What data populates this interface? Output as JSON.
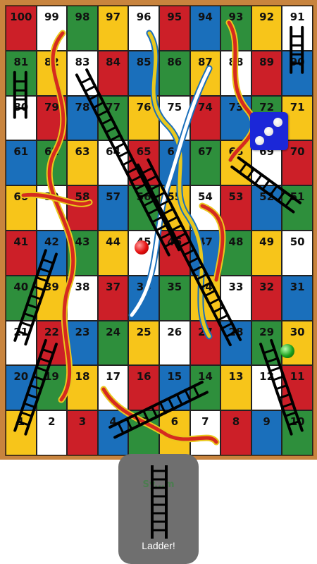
{
  "board": {
    "rows": [
      [
        100,
        99,
        98,
        97,
        96,
        95,
        94,
        93,
        92,
        91
      ],
      [
        81,
        82,
        83,
        84,
        85,
        86,
        87,
        88,
        89,
        90
      ],
      [
        80,
        79,
        78,
        77,
        76,
        75,
        74,
        73,
        72,
        71
      ],
      [
        61,
        62,
        63,
        64,
        65,
        66,
        67,
        68,
        69,
        70
      ],
      [
        60,
        59,
        58,
        57,
        56,
        55,
        54,
        53,
        52,
        51
      ],
      [
        41,
        42,
        43,
        44,
        45,
        46,
        47,
        48,
        49,
        50
      ],
      [
        40,
        39,
        38,
        37,
        36,
        35,
        34,
        33,
        32,
        31
      ],
      [
        21,
        22,
        23,
        24,
        25,
        26,
        27,
        28,
        29,
        30
      ],
      [
        20,
        19,
        18,
        17,
        16,
        15,
        14,
        13,
        12,
        11
      ],
      [
        1,
        2,
        3,
        4,
        5,
        6,
        7,
        8,
        9,
        10
      ]
    ],
    "colors": [
      [
        "red",
        "white",
        "green",
        "yellow",
        "white",
        "red",
        "blue",
        "green",
        "yellow",
        "white"
      ],
      [
        "green",
        "yellow",
        "white",
        "red",
        "blue",
        "green",
        "yellow",
        "white",
        "red",
        "blue"
      ],
      [
        "white",
        "red",
        "blue",
        "green",
        "yellow",
        "white",
        "red",
        "blue",
        "green",
        "yellow"
      ],
      [
        "blue",
        "green",
        "yellow",
        "white",
        "red",
        "blue",
        "green",
        "yellow",
        "white",
        "red"
      ],
      [
        "yellow",
        "white",
        "red",
        "blue",
        "green",
        "yellow",
        "white",
        "red",
        "blue",
        "green"
      ],
      [
        "red",
        "blue",
        "green",
        "yellow",
        "white",
        "red",
        "blue",
        "green",
        "yellow",
        "white"
      ],
      [
        "green",
        "yellow",
        "white",
        "red",
        "blue",
        "green",
        "yellow",
        "white",
        "red",
        "blue"
      ],
      [
        "white",
        "red",
        "blue",
        "green",
        "yellow",
        "white",
        "red",
        "blue",
        "green",
        "yellow"
      ],
      [
        "blue",
        "green",
        "yellow",
        "white",
        "red",
        "blue",
        "green",
        "yellow",
        "white",
        "red"
      ],
      [
        "yellow",
        "white",
        "red",
        "blue",
        "green",
        "yellow",
        "white",
        "red",
        "blue",
        "green"
      ]
    ]
  },
  "dice": {
    "value": 3,
    "color": "#1b27d8",
    "icon": "dice-three-icon"
  },
  "tokens": [
    {
      "name": "red-token",
      "square": 45,
      "color": "#e40d0d"
    },
    {
      "name": "green-token",
      "square": 30,
      "color": "#1ca11c"
    }
  ],
  "ladders": [
    {
      "from": 90,
      "to": 91
    },
    {
      "from": 80,
      "to": 81
    },
    {
      "from": 46,
      "to": 83
    },
    {
      "from": 28,
      "to": 65
    },
    {
      "from": 51,
      "to": 68
    },
    {
      "from": 10,
      "to": 29
    },
    {
      "from": 21,
      "to": 42
    },
    {
      "from": 1,
      "to": 22
    },
    {
      "from": 4,
      "to": 14
    }
  ],
  "popup": {
    "label": "Ladder!",
    "background_text": "Sy...m",
    "icon": "ladder-icon"
  },
  "colors": {
    "red": "#cc1f28",
    "yellow": "#f7c51a",
    "blue": "#1a6fbb",
    "green": "#2e8f3c",
    "white": "#ffffff",
    "frame": "#c8843e"
  }
}
